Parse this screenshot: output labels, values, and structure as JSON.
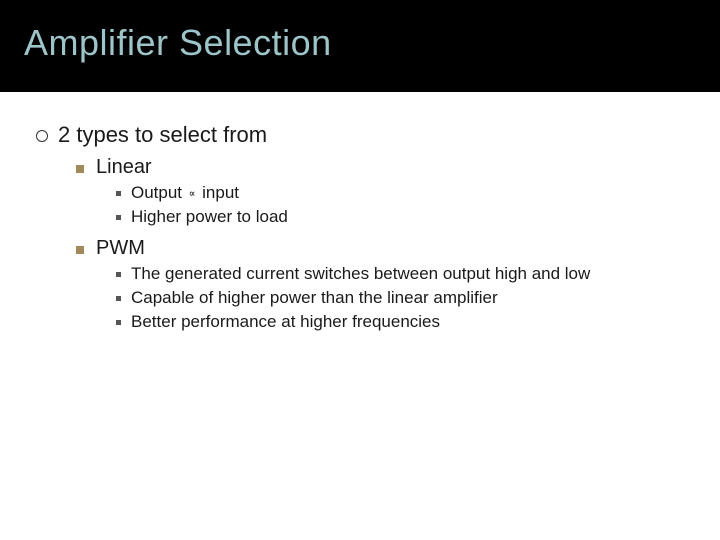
{
  "title": "Amplifier Selection",
  "main_point": "2 types to select from",
  "types": {
    "linear": {
      "label": "Linear",
      "sub": {
        "0a": "Output",
        "0sym": "∝",
        "0b": "input",
        "1": "Higher power to load"
      }
    },
    "pwm": {
      "label": "PWM",
      "sub": {
        "0": "The generated current switches between output high and low",
        "1": "Capable of higher power than the linear amplifier",
        "2": "Better performance at higher frequencies"
      }
    }
  }
}
